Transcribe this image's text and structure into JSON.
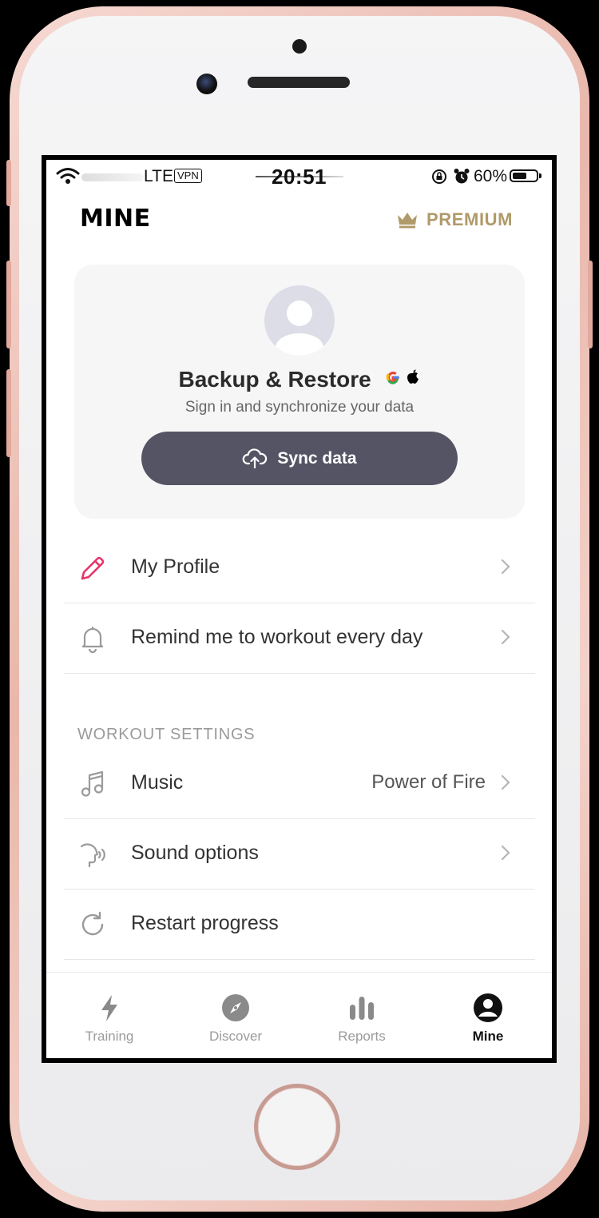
{
  "status_bar": {
    "network": "LTE",
    "vpn": "VPN",
    "time": "20:51",
    "battery": "60%"
  },
  "header": {
    "title": "MINE",
    "premium_label": "PREMIUM"
  },
  "backup_card": {
    "title": "Backup & Restore",
    "subtitle": "Sign in and synchronize your data",
    "sync_button": "Sync data"
  },
  "menu": {
    "profile": "My Profile",
    "reminder": "Remind me to workout every day"
  },
  "workout_settings": {
    "heading": "WORKOUT SETTINGS",
    "music_label": "Music",
    "music_value": "Power of Fire",
    "sound_label": "Sound options",
    "restart_label": "Restart progress"
  },
  "tabs": [
    {
      "label": "Training",
      "icon": "bolt-icon",
      "active": false
    },
    {
      "label": "Discover",
      "icon": "compass-icon",
      "active": false
    },
    {
      "label": "Reports",
      "icon": "bar-chart-icon",
      "active": false
    },
    {
      "label": "Mine",
      "icon": "person-circle-icon",
      "active": true
    }
  ],
  "colors": {
    "accent_pink": "#e8336a",
    "premium_gold": "#b09a6a",
    "sync_button_bg": "#545465",
    "card_bg": "#f6f6f7"
  }
}
